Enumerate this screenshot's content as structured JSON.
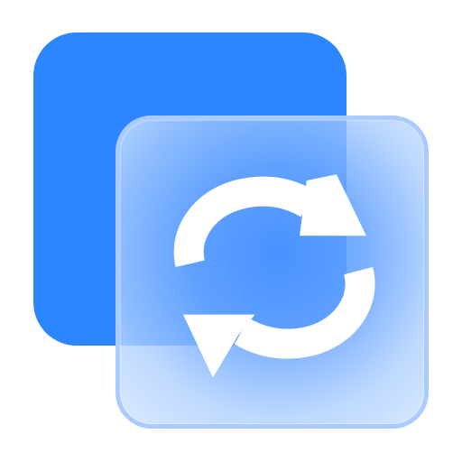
{
  "icon": {
    "name": "sync-icon",
    "colors": {
      "back": "#2b86ff",
      "front_border": "#a9cbff",
      "front_light": "#d7e8ff",
      "front_mid": "#68a5ff",
      "front_deep": "#4a92ff",
      "arrows": "#ffffff"
    }
  }
}
